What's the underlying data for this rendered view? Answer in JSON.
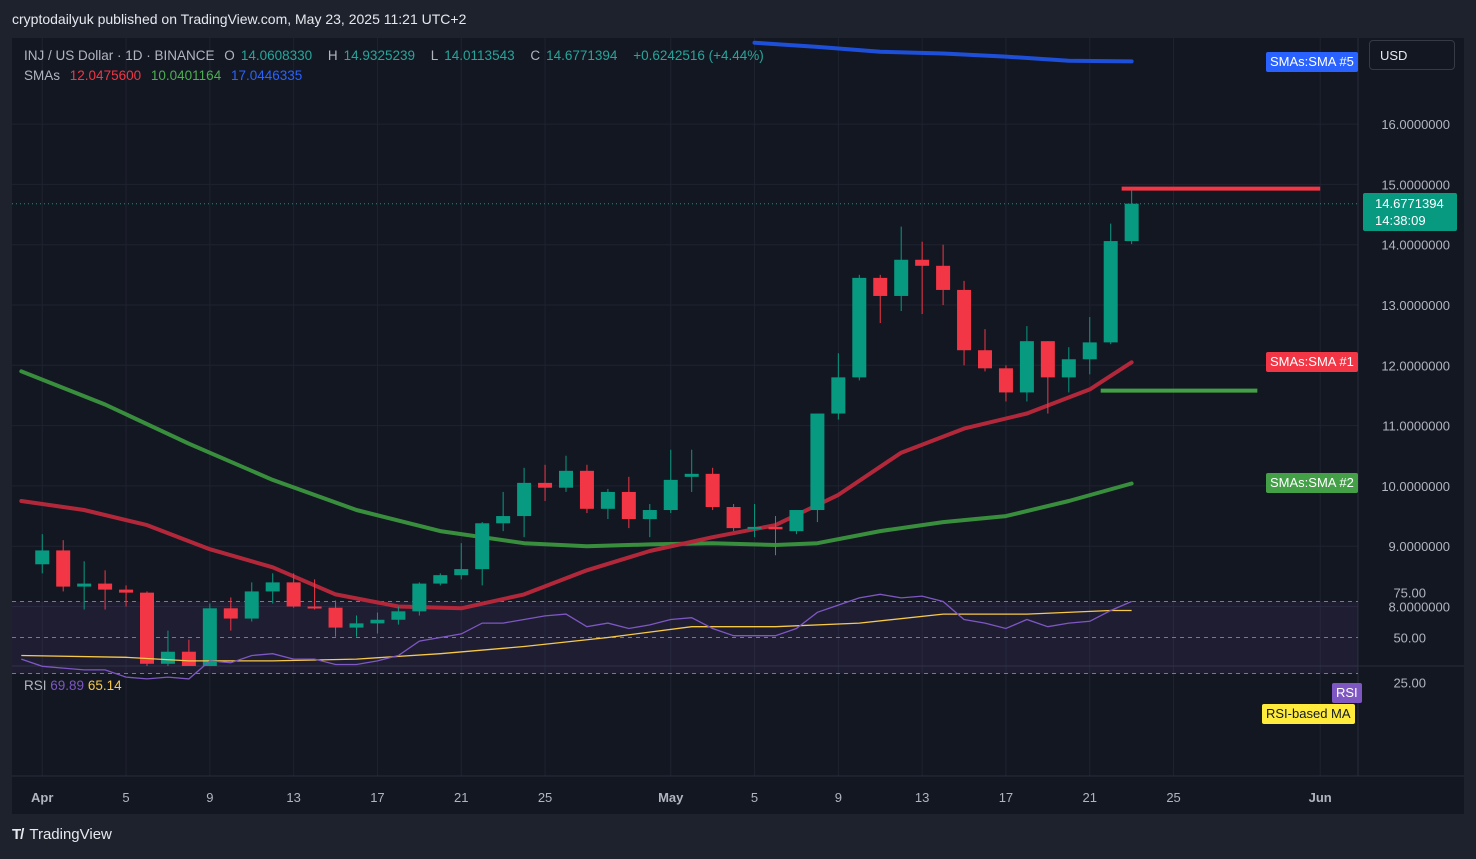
{
  "publisher_line": "cryptodailyuk published on TradingView.com, May 23, 2025 11:21 UTC+2",
  "legend": {
    "symbol": "INJ / US Dollar · 1D · BINANCE",
    "o_label": "O",
    "o_value": "14.0608330",
    "h_label": "H",
    "h_value": "14.9325239",
    "l_label": "L",
    "l_value": "14.0113543",
    "c_label": "C",
    "c_value": "14.6771394",
    "change": "+0.6242516 (+4.44%)",
    "smas_label": "SMAs",
    "sma1_value": "12.0475600",
    "sma2_value": "10.0401164",
    "sma5_value": "17.0446335"
  },
  "currency_button": "USD",
  "tags": {
    "sma5": "SMAs:SMA #5",
    "sma1": "SMAs:SMA #1",
    "sma2": "SMAs:SMA #2",
    "rsi": "RSI",
    "rsi_ma": "RSI-based MA"
  },
  "price_tag": {
    "price": "14.6771394",
    "countdown": "14:38:09"
  },
  "rsi_legend": {
    "label": "RSI",
    "rsi_value": "69.89",
    "ma_value": "65.14"
  },
  "footer_brand": "TradingView",
  "colors": {
    "up": "#089981",
    "down": "#f23645",
    "sma1": "#b2283a",
    "sma2": "#388e3c",
    "sma5": "#1e4fd8",
    "rsi": "#7e57c2",
    "rsi_ma": "#f7c948",
    "sma1_tag": "#f23645",
    "sma2_tag": "#43a047",
    "sma5_tag": "#2962ff",
    "rsi_tag": "#7e57c2",
    "rsi_ma_tag": "#ffeb3b"
  },
  "chart_data": {
    "type": "candlestick",
    "price_axis": {
      "ticks": [
        "16.0000000",
        "15.0000000",
        "14.0000000",
        "13.0000000",
        "12.0000000",
        "11.0000000",
        "10.0000000",
        "9.0000000",
        "8.0000000"
      ],
      "tick_values": [
        16,
        15,
        14,
        13,
        12,
        11,
        10,
        9,
        8
      ]
    },
    "date_axis": {
      "labels": [
        "Apr",
        "5",
        "9",
        "13",
        "17",
        "21",
        "25",
        "May",
        "5",
        "9",
        "13",
        "17",
        "21",
        "25",
        "Jun"
      ],
      "label_days": [
        1,
        5,
        9,
        13,
        17,
        21,
        25,
        31,
        35,
        39,
        43,
        47,
        51,
        55,
        62
      ]
    },
    "candles": [
      {
        "day": 1,
        "o": 8.7,
        "h": 9.2,
        "l": 8.55,
        "c": 8.93
      },
      {
        "day": 2,
        "o": 8.93,
        "h": 9.1,
        "l": 8.25,
        "c": 8.33
      },
      {
        "day": 3,
        "o": 8.33,
        "h": 8.75,
        "l": 7.95,
        "c": 8.38
      },
      {
        "day": 4,
        "o": 8.38,
        "h": 8.6,
        "l": 7.95,
        "c": 8.28
      },
      {
        "day": 5,
        "o": 8.28,
        "h": 8.35,
        "l": 8.0,
        "c": 8.23
      },
      {
        "day": 6,
        "o": 8.23,
        "h": 8.25,
        "l": 6.95,
        "c": 7.05
      },
      {
        "day": 7,
        "o": 7.05,
        "h": 7.6,
        "l": 6.95,
        "c": 7.25
      },
      {
        "day": 8,
        "o": 7.25,
        "h": 7.45,
        "l": 6.9,
        "c": 7.0
      },
      {
        "day": 9,
        "o": 7.0,
        "h": 8.05,
        "l": 6.95,
        "c": 7.97
      },
      {
        "day": 10,
        "o": 7.97,
        "h": 8.15,
        "l": 7.6,
        "c": 7.8
      },
      {
        "day": 11,
        "o": 7.8,
        "h": 8.4,
        "l": 7.75,
        "c": 8.25
      },
      {
        "day": 12,
        "o": 8.25,
        "h": 8.55,
        "l": 8.05,
        "c": 8.4
      },
      {
        "day": 13,
        "o": 8.4,
        "h": 8.55,
        "l": 7.98,
        "c": 8.0
      },
      {
        "day": 14,
        "o": 8.0,
        "h": 8.45,
        "l": 7.95,
        "c": 7.98
      },
      {
        "day": 15,
        "o": 7.98,
        "h": 8.1,
        "l": 7.5,
        "c": 7.65
      },
      {
        "day": 16,
        "o": 7.65,
        "h": 7.85,
        "l": 7.5,
        "c": 7.72
      },
      {
        "day": 17,
        "o": 7.72,
        "h": 7.9,
        "l": 7.55,
        "c": 7.78
      },
      {
        "day": 18,
        "o": 7.78,
        "h": 8.0,
        "l": 7.7,
        "c": 7.92
      },
      {
        "day": 19,
        "o": 7.92,
        "h": 8.4,
        "l": 7.85,
        "c": 8.38
      },
      {
        "day": 20,
        "o": 8.38,
        "h": 8.55,
        "l": 8.35,
        "c": 8.52
      },
      {
        "day": 21,
        "o": 8.52,
        "h": 9.05,
        "l": 8.45,
        "c": 8.62
      },
      {
        "day": 22,
        "o": 8.62,
        "h": 9.4,
        "l": 8.35,
        "c": 9.38
      },
      {
        "day": 23,
        "o": 9.38,
        "h": 9.9,
        "l": 9.25,
        "c": 9.5
      },
      {
        "day": 24,
        "o": 9.5,
        "h": 10.3,
        "l": 9.15,
        "c": 10.05
      },
      {
        "day": 25,
        "o": 10.05,
        "h": 10.35,
        "l": 9.75,
        "c": 9.97
      },
      {
        "day": 26,
        "o": 9.97,
        "h": 10.5,
        "l": 9.9,
        "c": 10.25
      },
      {
        "day": 27,
        "o": 10.25,
        "h": 10.35,
        "l": 9.55,
        "c": 9.62
      },
      {
        "day": 28,
        "o": 9.62,
        "h": 9.95,
        "l": 9.45,
        "c": 9.9
      },
      {
        "day": 29,
        "o": 9.9,
        "h": 10.15,
        "l": 9.3,
        "c": 9.45
      },
      {
        "day": 30,
        "o": 9.45,
        "h": 9.7,
        "l": 9.15,
        "c": 9.6
      },
      {
        "day": 31,
        "o": 9.6,
        "h": 10.6,
        "l": 9.55,
        "c": 10.1
      },
      {
        "day": 32,
        "o": 10.15,
        "h": 10.6,
        "l": 9.9,
        "c": 10.2
      },
      {
        "day": 33,
        "o": 10.2,
        "h": 10.3,
        "l": 9.6,
        "c": 9.65
      },
      {
        "day": 34,
        "o": 9.65,
        "h": 9.7,
        "l": 9.25,
        "c": 9.3
      },
      {
        "day": 35,
        "o": 9.3,
        "h": 9.7,
        "l": 9.15,
        "c": 9.32
      },
      {
        "day": 36,
        "o": 9.32,
        "h": 9.5,
        "l": 8.85,
        "c": 9.28
      },
      {
        "day": 37,
        "o": 9.25,
        "h": 9.6,
        "l": 9.2,
        "c": 9.6
      },
      {
        "day": 38,
        "o": 9.6,
        "h": 11.2,
        "l": 9.4,
        "c": 11.2
      },
      {
        "day": 39,
        "o": 11.2,
        "h": 12.2,
        "l": 11.1,
        "c": 11.8
      },
      {
        "day": 40,
        "o": 11.8,
        "h": 13.5,
        "l": 11.75,
        "c": 13.45
      },
      {
        "day": 41,
        "o": 13.45,
        "h": 13.5,
        "l": 12.7,
        "c": 13.15
      },
      {
        "day": 42,
        "o": 13.15,
        "h": 14.3,
        "l": 12.9,
        "c": 13.75
      },
      {
        "day": 43,
        "o": 13.75,
        "h": 14.05,
        "l": 12.85,
        "c": 13.65
      },
      {
        "day": 44,
        "o": 13.65,
        "h": 14.0,
        "l": 13.0,
        "c": 13.25
      },
      {
        "day": 45,
        "o": 13.25,
        "h": 13.4,
        "l": 12.0,
        "c": 12.25
      },
      {
        "day": 46,
        "o": 12.25,
        "h": 12.6,
        "l": 11.9,
        "c": 11.95
      },
      {
        "day": 47,
        "o": 11.95,
        "h": 12.0,
        "l": 11.4,
        "c": 11.55
      },
      {
        "day": 48,
        "o": 11.55,
        "h": 12.65,
        "l": 11.4,
        "c": 12.4
      },
      {
        "day": 49,
        "o": 12.4,
        "h": 12.4,
        "l": 11.2,
        "c": 11.8
      },
      {
        "day": 50,
        "o": 11.8,
        "h": 12.3,
        "l": 11.55,
        "c": 12.1
      },
      {
        "day": 51,
        "o": 12.1,
        "h": 12.8,
        "l": 11.85,
        "c": 12.38
      },
      {
        "day": 52,
        "o": 12.38,
        "h": 14.35,
        "l": 12.35,
        "c": 14.06
      },
      {
        "day": 53,
        "o": 14.06,
        "h": 14.93,
        "l": 14.01,
        "c": 14.68
      }
    ],
    "sma1": {
      "name": "SMA #1",
      "days": [
        0,
        3,
        6,
        9,
        12,
        15,
        18,
        21,
        24,
        27,
        30,
        33,
        36,
        39,
        42,
        45,
        48,
        51,
        53
      ],
      "values": [
        9.75,
        9.6,
        9.35,
        8.95,
        8.65,
        8.2,
        8.0,
        7.97,
        8.2,
        8.6,
        8.92,
        9.15,
        9.35,
        9.85,
        10.55,
        10.95,
        11.2,
        11.6,
        12.05
      ]
    },
    "sma2": {
      "name": "SMA #2",
      "days": [
        0,
        4,
        8,
        12,
        16,
        20,
        24,
        27,
        30,
        33,
        36,
        38,
        41,
        44,
        47,
        50,
        53
      ],
      "values": [
        11.9,
        11.35,
        10.7,
        10.1,
        9.6,
        9.25,
        9.05,
        9.0,
        9.03,
        9.05,
        9.02,
        9.05,
        9.25,
        9.4,
        9.5,
        9.75,
        10.04
      ]
    },
    "sma5": {
      "name": "SMA #5",
      "days": [
        35,
        38,
        41,
        44,
        47,
        50,
        53
      ],
      "values": [
        17.35,
        17.28,
        17.2,
        17.17,
        17.12,
        17.05,
        17.04
      ]
    },
    "pivot_lines": [
      {
        "value": 14.93,
        "from_day": 53,
        "to_day": 62,
        "color": "#f23645"
      },
      {
        "value": 11.58,
        "from_day": 52,
        "to_day": 59,
        "color": "#43a047"
      }
    ],
    "rsi_axis": {
      "ticks": [
        "75.00",
        "50.00",
        "25.00"
      ],
      "tick_values": [
        75,
        50,
        25
      ]
    },
    "rsi": {
      "days": [
        0,
        1,
        2,
        3,
        4,
        5,
        6,
        7,
        8,
        9,
        10,
        11,
        12,
        13,
        14,
        15,
        16,
        17,
        18,
        19,
        20,
        21,
        22,
        23,
        24,
        25,
        26,
        27,
        28,
        29,
        30,
        31,
        32,
        33,
        34,
        35,
        36,
        37,
        38,
        39,
        40,
        41,
        42,
        43,
        44,
        45,
        46,
        47,
        48,
        49,
        50,
        51,
        52,
        53
      ],
      "values": [
        38,
        34,
        33,
        32,
        32,
        28,
        27,
        28,
        27,
        37,
        36,
        40,
        41,
        38,
        38,
        35,
        35,
        37,
        40,
        48,
        50,
        52,
        58,
        58,
        60,
        62,
        63,
        56,
        58,
        55,
        57,
        60,
        61,
        55,
        51,
        51,
        51,
        55,
        64,
        68,
        72,
        74,
        72,
        73,
        70,
        60,
        58,
        55,
        60,
        56,
        58,
        59,
        65,
        70
      ]
    },
    "rsi_ma": {
      "days": [
        0,
        5,
        8,
        12,
        16,
        20,
        24,
        28,
        32,
        36,
        40,
        44,
        48,
        52,
        53
      ],
      "values": [
        40,
        39,
        37,
        37,
        38,
        41,
        45,
        50,
        56,
        56,
        58,
        63,
        63,
        65,
        65
      ]
    }
  }
}
